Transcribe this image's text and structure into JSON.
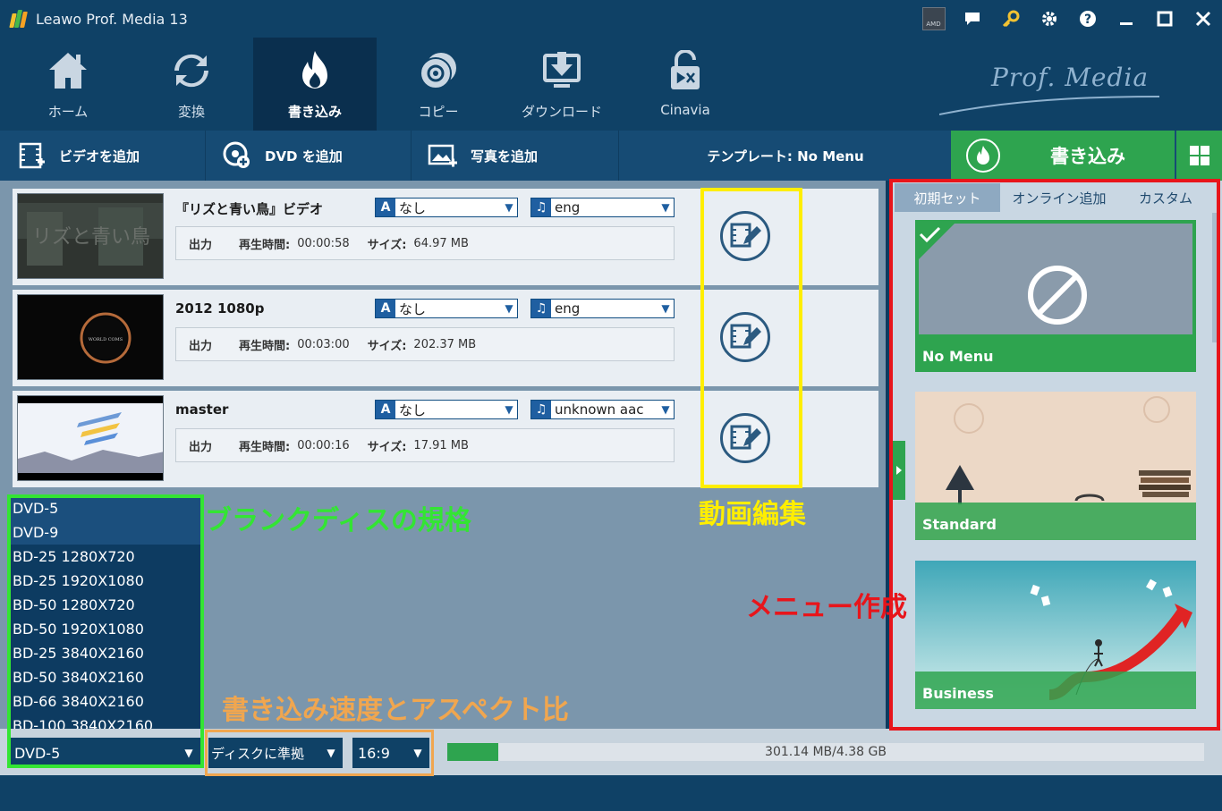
{
  "app": {
    "title": "Leawo Prof. Media 13",
    "brand": "Prof. Media"
  },
  "window_tools": {
    "amd": "AMD",
    "minimize": "—",
    "maximize": "▢",
    "close": "✕"
  },
  "nav": [
    {
      "label": "ホーム",
      "icon": "home-icon"
    },
    {
      "label": "変換",
      "icon": "convert-icon"
    },
    {
      "label": "書き込み",
      "icon": "burn-icon",
      "active": true
    },
    {
      "label": "コピー",
      "icon": "copy-disc-icon"
    },
    {
      "label": "ダウンロード",
      "icon": "download-icon"
    },
    {
      "label": "Cinavia",
      "icon": "cinavia-lock-icon"
    }
  ],
  "toolbar": {
    "add_video": "ビデオを追加",
    "add_dvd": "DVD を追加",
    "add_photo": "写真を追加",
    "template": "テンプレート: No Menu",
    "burn": "書き込み"
  },
  "items": [
    {
      "title": "『リズと青い鳥』ビデオ",
      "subtitle": "なし",
      "audio": "eng",
      "output": "出力",
      "duration_label": "再生時間:",
      "duration": "00:00:58",
      "size_label": "サイズ:",
      "size": "64.97 MB",
      "thumb_text": "リズと青い鳥"
    },
    {
      "title": "2012 1080p",
      "subtitle": "なし",
      "audio": "eng",
      "output": "出力",
      "duration_label": "再生時間:",
      "duration": "00:03:00",
      "size_label": "サイズ:",
      "size": "202.37 MB",
      "thumb_text": "WORLD COMS"
    },
    {
      "title": "master",
      "subtitle": "なし",
      "audio": "unknown aac",
      "output": "出力",
      "duration_label": "再生時間:",
      "duration": "00:00:16",
      "size_label": "サイズ:",
      "size": "17.91 MB",
      "thumb_text": ""
    }
  ],
  "annotations": {
    "disc_spec": "ブランクディスの規格",
    "video_edit": "動画編集",
    "menu_create": "メニュー作成",
    "speed_aspect": "書き込み速度とアスペクト比"
  },
  "disc_options": [
    "DVD-5",
    "DVD-9",
    "BD-25 1280X720",
    "BD-25 1920X1080",
    "BD-50 1280X720",
    "BD-50 1920X1080",
    "BD-25 3840X2160",
    "BD-50 3840X2160",
    "BD-66 3840X2160",
    "BD-100 3840X2160"
  ],
  "bottom": {
    "disc": "DVD-5",
    "speed": "ディスクに準拠",
    "aspect": "16:9",
    "capacity_text": "301.14 MB/4.38 GB",
    "capacity_fraction": 0.067
  },
  "template_panel": {
    "tabs": [
      "初期セット",
      "オンライン追加",
      "カスタム"
    ],
    "templates": [
      {
        "label": "No Menu",
        "selected": true
      },
      {
        "label": "Standard"
      },
      {
        "label": "Business"
      }
    ]
  },
  "colors": {
    "accent_green": "#2ea44f",
    "annot_green": "#33e533",
    "annot_yellow": "#ffee00",
    "annot_red": "#e8151b",
    "annot_orange": "#f0a64f"
  }
}
